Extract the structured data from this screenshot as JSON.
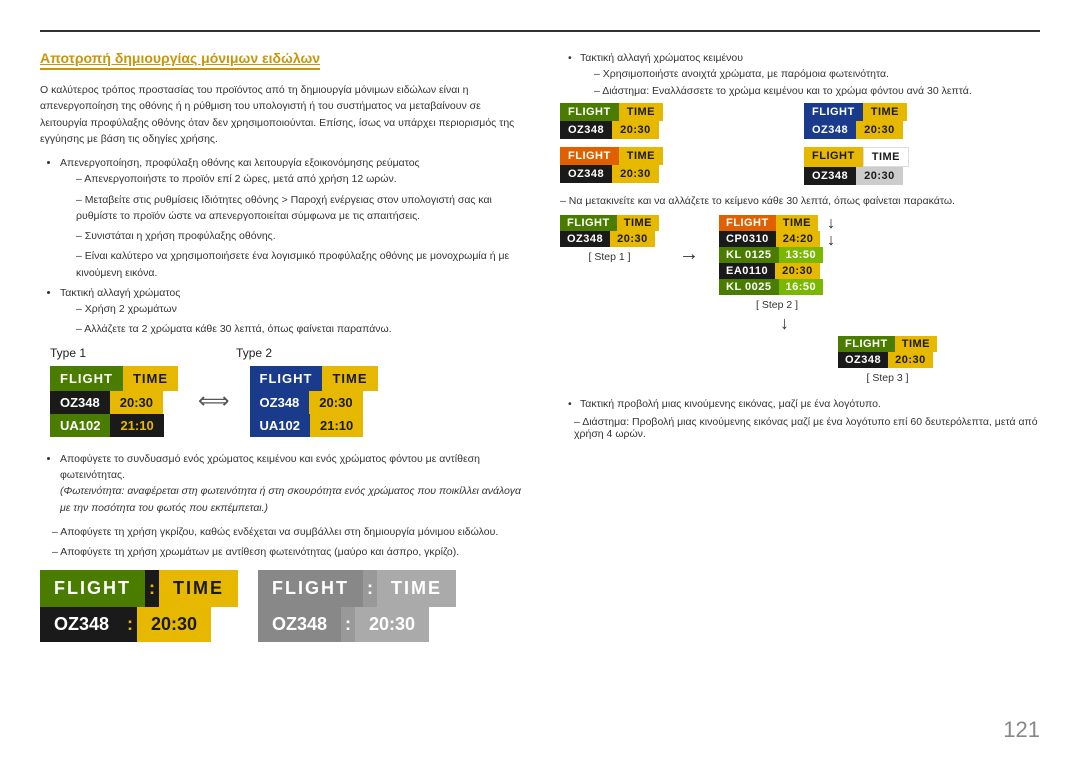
{
  "page": {
    "number": "121"
  },
  "section_title": "Αποτροπή δημιουργίας μόνιμων ειδώλων",
  "left": {
    "para1": "Ο καλύτερος τρόπος προστασίας του προϊόντος από τη δημιουργία μόνιμων ειδώλων είναι η απενεργοποίηση της οθόνης ή η ρύθμιση του υπολογιστή ή του συστήματος να μεταβαίνουν σε λειτουργία προφύλαξης οθόνης όταν δεν χρησιμοποιούνται. Επίσης, ίσως να υπάρχει περιορισμός της εγγύησης με βάση τις οδηγίες χρήσης.",
    "bullet1": "Απενεργοποίηση, προφύλαξη οθόνης και λειτουργία εξοικονόμησης ρεύματος",
    "sub1a": "Απενεργοποιήστε το προϊόν επί 2 ώρες, μετά από χρήση 12 ωρών.",
    "sub1b": "Μεταβείτε στις ρυθμίσεις Ιδιότητες οθόνης > Παροχή ενέργειας στον υπολογιστή σας και ρυθμίστε το προϊόν ώστε να απενεργοποιείται σύμφωνα με τις απαιτήσεις.",
    "sub1c": "Συνιστάται η χρήση προφύλαξης οθόνης.",
    "sub1d": "Είναι καλύτερο να χρησιμοποιήσετε ένα λογισμικό προφύλαξης οθόνης με μονοχρωμία ή με κινούμενη εικόνα.",
    "bullet2": "Τακτική αλλαγή χρώματος",
    "sub2a": "Χρήση 2 χρωμάτων",
    "sub2b": "Αλλάζετε τα 2 χρώματα κάθε 30 λεπτά, όπως φαίνεται παραπάνω.",
    "type1_label": "Type 1",
    "type2_label": "Type 2",
    "board1": {
      "header": [
        "FLIGHT",
        "TIME"
      ],
      "rows": [
        [
          "OZ348",
          "20:30"
        ],
        [
          "UA102",
          "21:10"
        ]
      ]
    },
    "board2": {
      "header": [
        "FLIGHT",
        "TIME"
      ],
      "rows": [
        [
          "OZ348",
          "20:30"
        ],
        [
          "UA102",
          "21:10"
        ]
      ]
    },
    "warning1": "Αποφύγετε το συνδυασμό ενός χρώματος κειμένου και ενός χρώματος φόντου με αντίθεση φωτεινότητας.",
    "note1": "(Φωτεινότητα: αναφέρεται στη φωτεινότητα ή στη σκουρότητα ενός χρώματος που ποικίλλει ανάλογα με την ποσότητα του φωτός που εκπέμπεται.)",
    "dash1": "Αποφύγετε τη χρήση γκρίζου, καθώς ενδέχεται να συμβάλλει στη δημιουργία μόνιμου ειδώλου.",
    "dash2": "Αποφύγετε τη χρήση χρωμάτων με αντίθεση φωτεινότητας (μαύρο και άσπρο, γκρίζο).",
    "bottom_board1": {
      "header": [
        "FLIGHT",
        ":",
        "TIME"
      ],
      "row": [
        "OZ348",
        ":",
        "20:30"
      ]
    },
    "bottom_board2": {
      "header": [
        "FLIGHT",
        ":",
        "TIME"
      ],
      "row": [
        "OZ348",
        ":",
        "20:30"
      ]
    }
  },
  "right": {
    "bullet1": "Τακτική αλλαγή χρώματος κειμένου",
    "sub1a": "Χρησιμοποιήστε ανοιχτά χρώματα, με παρόμοια φωτεινότητα.",
    "sub1b": "Διάστημα: Εναλλάσσετε το χρώμα κειμένου και το χρώμα φόντου ανά 30 λεπτά.",
    "boards": {
      "board_tl": {
        "header": [
          "FLIGHT",
          "TIME"
        ],
        "row": [
          "OZ348",
          "20:30"
        ]
      },
      "board_tr": {
        "header": [
          "FLIGHT",
          "TIME"
        ],
        "row": [
          "OZ348",
          "20:30"
        ]
      },
      "board_ml": {
        "header": [
          "FLIGHT",
          "TIME"
        ],
        "row": [
          "OZ348",
          "20:30"
        ]
      },
      "board_mr": {
        "header": [
          "FLIGHT",
          "TIME"
        ],
        "row": [
          "OZ348",
          "20:30"
        ]
      }
    },
    "step_note": "– Να μετακινείτε και να αλλάζετε το κείμενο κάθε 30 λεπτά, όπως φαίνεται παρακάτω.",
    "step1_label": "[ Step 1 ]",
    "step2_label": "[ Step 2 ]",
    "step3_label": "[ Step 3 ]",
    "step1_board": {
      "header": [
        "FLIGHT",
        "TIME"
      ],
      "row": [
        "OZ348",
        "20:30"
      ]
    },
    "step2_board": {
      "rows": [
        [
          "CP0310",
          "24:20"
        ],
        [
          "KL0125",
          "13:50"
        ],
        [
          "EA0110",
          "20:30"
        ],
        [
          "KL0025",
          "16:50"
        ]
      ]
    },
    "step3_board": {
      "header": [
        "FLIGHT",
        "TIME"
      ],
      "row": [
        "OZ348",
        "20:30"
      ]
    },
    "bullet2": "Τακτική προβολή μιας κινούμενης εικόνας, μαζί με ένα λογότυπο.",
    "sub2": "Διάστημα: Προβολή μιας κινούμενης εικόνας μαζί με ένα λογότυπο επί 60 δευτερόλεπτα, μετά από χρήση 4 ωρών."
  }
}
